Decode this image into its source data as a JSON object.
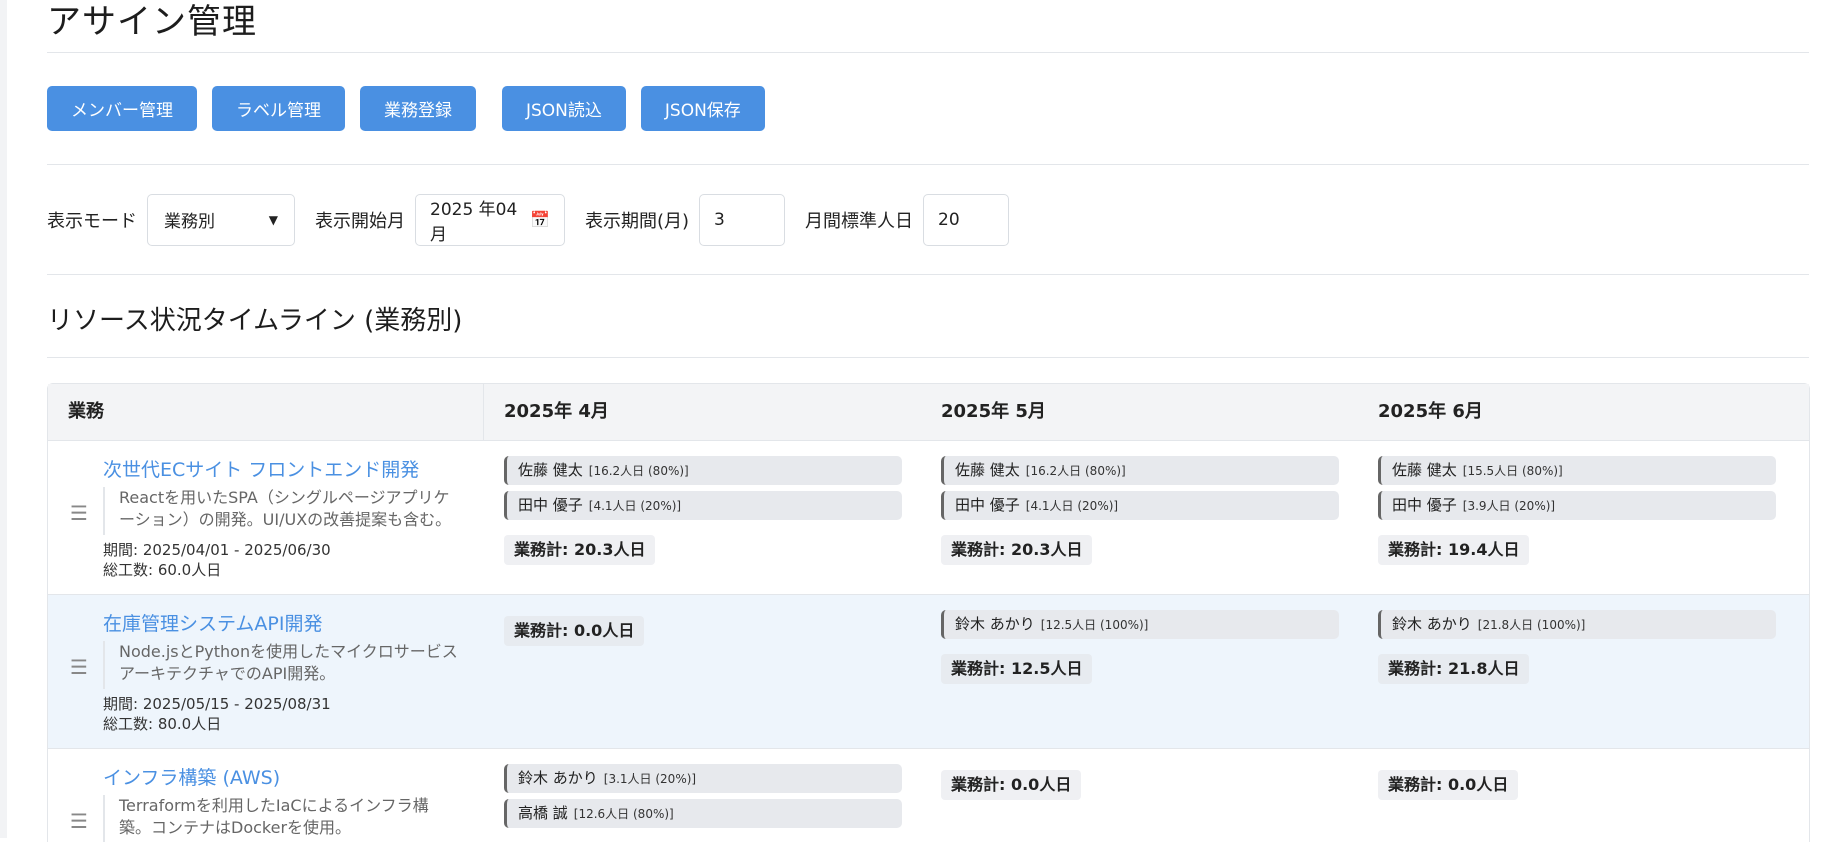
{
  "page": {
    "title": "アサイン管理"
  },
  "toolbar": {
    "buttons": [
      {
        "label": "メンバー管理"
      },
      {
        "label": "ラベル管理"
      },
      {
        "label": "業務登録"
      },
      {
        "label": "JSON読込"
      },
      {
        "label": "JSON保存"
      }
    ]
  },
  "controls": {
    "mode_label": "表示モード",
    "mode_value": "業務別",
    "start_label": "表示開始月",
    "start_value": "2025 年04月",
    "period_label": "表示期間(月)",
    "period_value": "3",
    "std_label": "月間標準人日",
    "std_value": "20"
  },
  "timeline": {
    "title": "リソース状況タイムライン (業務別)",
    "headers": [
      "業務",
      "2025年 4月",
      "2025年 5月",
      "2025年 6月"
    ],
    "rows": [
      {
        "title": "次世代ECサイト フロントエンド開発",
        "desc": "Reactを用いたSPA（シングルページアプリケーション）の開発。UI/UXの改善提案も含む。",
        "period": "期間: 2025/04/01 - 2025/06/30",
        "effort": "総工数: 60.0人日",
        "months": [
          {
            "assigns": [
              {
                "name": "佐藤 健太",
                "detail": "[16.2人日 (80%)]"
              },
              {
                "name": "田中 優子",
                "detail": "[4.1人日 (20%)]"
              }
            ],
            "total": "業務計: 20.3人日"
          },
          {
            "assigns": [
              {
                "name": "佐藤 健太",
                "detail": "[16.2人日 (80%)]"
              },
              {
                "name": "田中 優子",
                "detail": "[4.1人日 (20%)]"
              }
            ],
            "total": "業務計: 20.3人日"
          },
          {
            "assigns": [
              {
                "name": "佐藤 健太",
                "detail": "[15.5人日 (80%)]"
              },
              {
                "name": "田中 優子",
                "detail": "[3.9人日 (20%)]"
              }
            ],
            "total": "業務計: 19.4人日"
          }
        ]
      },
      {
        "title": "在庫管理システムAPI開発",
        "desc": "Node.jsとPythonを使用したマイクロサービスアーキテクチャでのAPI開発。",
        "period": "期間: 2025/05/15 - 2025/08/31",
        "effort": "総工数: 80.0人日",
        "months": [
          {
            "assigns": [],
            "total": "業務計: 0.0人日"
          },
          {
            "assigns": [
              {
                "name": "鈴木 あかり",
                "detail": "[12.5人日 (100%)]"
              }
            ],
            "total": "業務計: 12.5人日"
          },
          {
            "assigns": [
              {
                "name": "鈴木 あかり",
                "detail": "[21.8人日 (100%)]"
              }
            ],
            "total": "業務計: 21.8人日"
          }
        ]
      },
      {
        "title": "インフラ構築 (AWS)",
        "desc": "Terraformを利用したIaCによるインフラ構築。コンテナはDockerを使用。",
        "period": "",
        "effort": "",
        "months": [
          {
            "assigns": [
              {
                "name": "鈴木 あかり",
                "detail": "[3.1人日 (20%)]"
              },
              {
                "name": "高橋 誠",
                "detail": "[12.6人日 (80%)]"
              }
            ],
            "total": ""
          },
          {
            "assigns": [],
            "total": "業務計: 0.0人日"
          },
          {
            "assigns": [],
            "total": "業務計: 0.0人日"
          }
        ]
      }
    ]
  }
}
